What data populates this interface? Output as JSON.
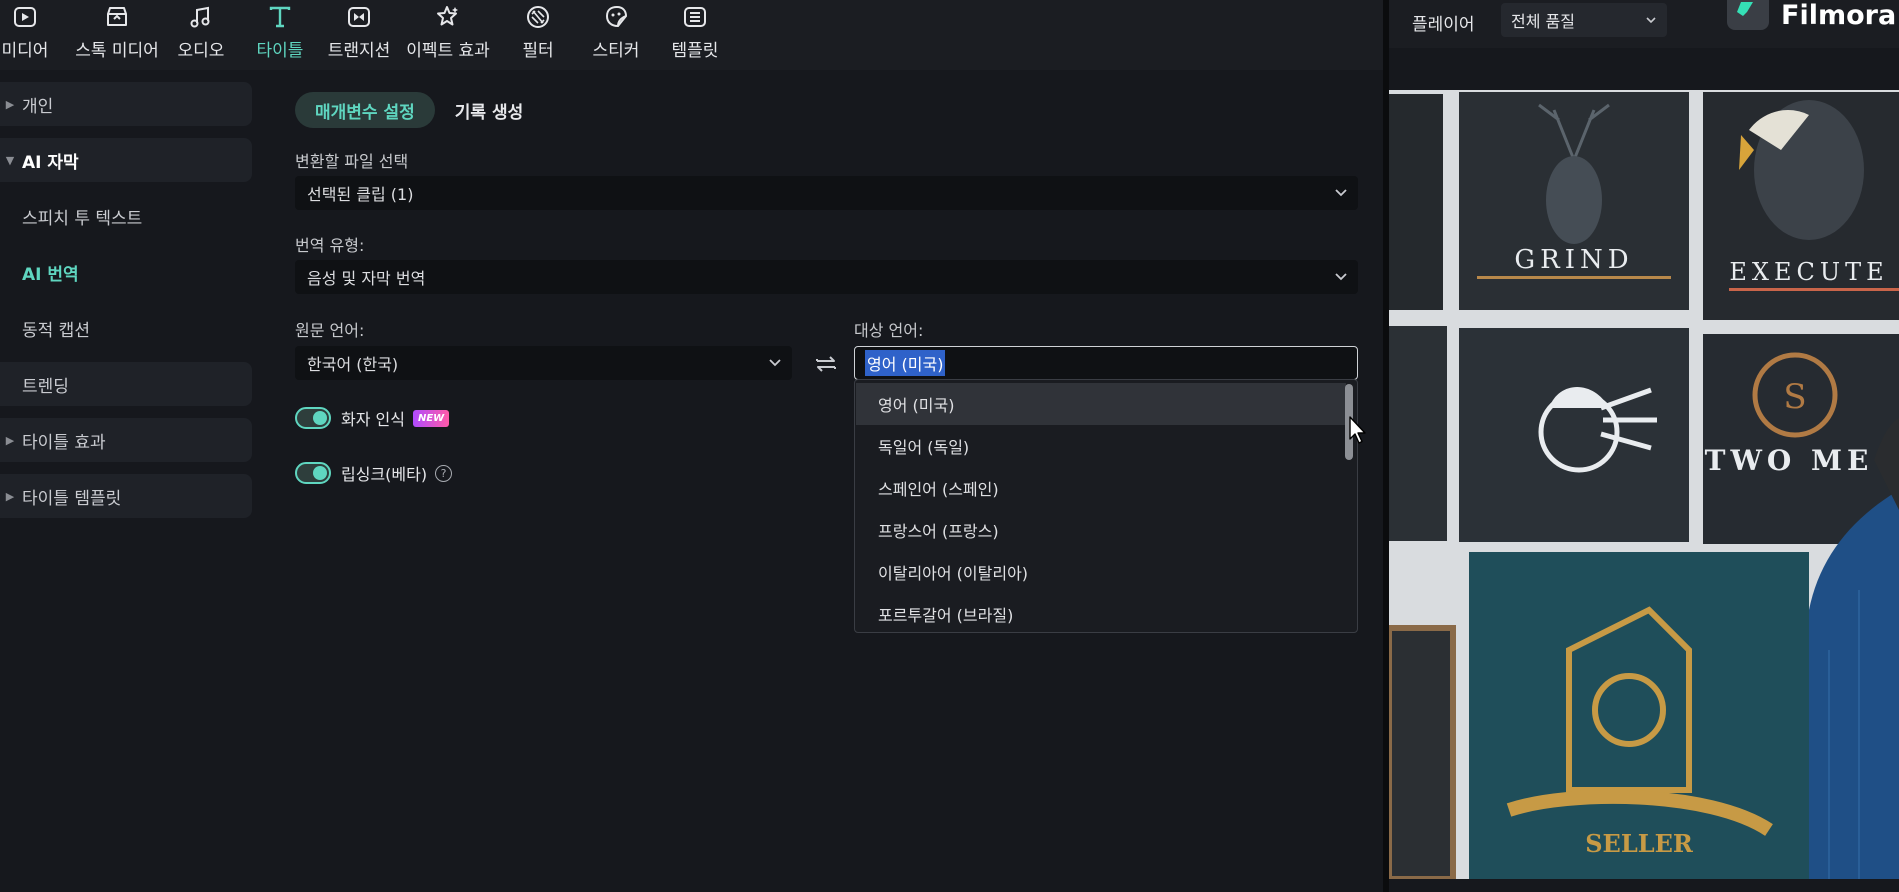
{
  "toolbar": {
    "items": [
      {
        "label": "미디어",
        "icon": "media-icon"
      },
      {
        "label": "스톡 미디어",
        "icon": "stock-media-icon"
      },
      {
        "label": "오디오",
        "icon": "music-note-icon"
      },
      {
        "label": "타이틀",
        "icon": "title-t-icon",
        "active": true
      },
      {
        "label": "트랜지션",
        "icon": "transition-icon"
      },
      {
        "label": "이펙트 효과",
        "icon": "effects-star-icon"
      },
      {
        "label": "필터",
        "icon": "filter-icon"
      },
      {
        "label": "스티커",
        "icon": "sticker-icon"
      },
      {
        "label": "템플릿",
        "icon": "template-icon"
      }
    ],
    "accent": "#5fd6c0"
  },
  "leftnav": {
    "items": [
      {
        "label": "개인",
        "state": "collapsed"
      },
      {
        "label": "AI 자막",
        "state": "expanded"
      },
      {
        "label": "스피치 투 텍스트",
        "state": "child"
      },
      {
        "label": "AI 번역",
        "state": "selected"
      },
      {
        "label": "동적 캡션",
        "state": "child"
      },
      {
        "label": "트렌딩",
        "state": "leaf"
      },
      {
        "label": "타이틀 효과",
        "state": "collapsed"
      },
      {
        "label": "타이틀 템플릿",
        "state": "collapsed"
      }
    ]
  },
  "main": {
    "tabs": [
      {
        "label": "매개변수 설정",
        "active": true
      },
      {
        "label": "기록 생성",
        "active": false
      }
    ],
    "file_label": "변환할 파일 선택",
    "file_value": "선택된 클립 (1)",
    "type_label": "번역 유형:",
    "type_value": "음성 및 자막 번역",
    "source_label": "원문 언어:",
    "source_value": "한국어 (한국)",
    "target_label": "대상 언어:",
    "target_value": "영어 (미국)",
    "speaker_label": "화자 인식",
    "new_badge": "NEW",
    "lipsync_label": "립싱크(베타)",
    "help_glyph": "?",
    "dropdown_options": [
      "영어 (미국)",
      "독일어 (독일)",
      "스페인어 (스페인)",
      "프랑스어 (프랑스)",
      "이탈리아어 (이탈리아)",
      "포르투갈어 (브라질)"
    ]
  },
  "player": {
    "label": "플레이어",
    "quality": "전체 품질",
    "brand": "Filmora",
    "posters": [
      "GRIND",
      "EXECUTE",
      "TWO ME",
      "SELLER"
    ]
  }
}
